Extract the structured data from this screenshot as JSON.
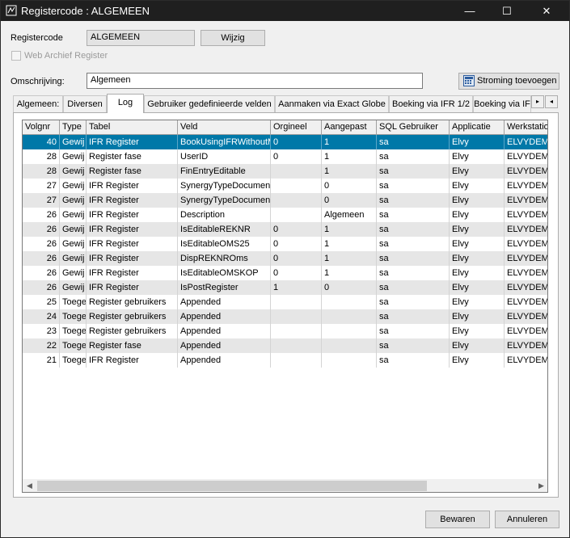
{
  "window": {
    "title": "Registercode : ALGEMEEN",
    "minimize": "—",
    "maximize": "☐",
    "close": "✕"
  },
  "form": {
    "registercode_label": "Registercode",
    "registercode_value": "ALGEMEEN",
    "wijzig_button": "Wijzig",
    "web_archief_label": "Web Archief Register",
    "omschrijving_label": "Omschrijving:",
    "omschrijving_value": "Algemeen",
    "stroming_button": "Stroming toevoegen"
  },
  "tabs": [
    "Algemeen:",
    "Diversen",
    "Log",
    "Gebruiker gedefinieerde velden",
    "Aanmaken via Exact Globe",
    "Boeking via IFR 1/2",
    "Boeking via IF"
  ],
  "tab_scroll": {
    "left": "◂",
    "right": "▸"
  },
  "grid": {
    "columns": [
      "Volgnr",
      "Type",
      "Tabel",
      "Veld",
      "Orgineel",
      "Aangepast",
      "SQL Gebruiker",
      "Applicatie",
      "Werkstatio"
    ],
    "rows": [
      [
        "40",
        "Gewij",
        "IFR Register",
        "BookUsingIFRWithoutM",
        "0",
        "1",
        "sa",
        "Elvy",
        "ELVYDEMO"
      ],
      [
        "28",
        "Gewij",
        "Register fase",
        "UserID",
        "0",
        "1",
        "sa",
        "Elvy",
        "ELVYDEMO"
      ],
      [
        "28",
        "Gewij",
        "Register fase",
        "FinEntryEditable",
        "",
        "1",
        "sa",
        "Elvy",
        "ELVYDEMO"
      ],
      [
        "27",
        "Gewij",
        "IFR Register",
        "SynergyTypeDocumen",
        "",
        "0",
        "sa",
        "Elvy",
        "ELVYDEMO"
      ],
      [
        "27",
        "Gewij",
        "IFR Register",
        "SynergyTypeDocumen",
        "",
        "0",
        "sa",
        "Elvy",
        "ELVYDEMO"
      ],
      [
        "26",
        "Gewij",
        "IFR Register",
        "Description",
        "",
        "Algemeen",
        "sa",
        "Elvy",
        "ELVYDEMO"
      ],
      [
        "26",
        "Gewij",
        "IFR Register",
        "IsEditableREKNR",
        "0",
        "1",
        "sa",
        "Elvy",
        "ELVYDEMO"
      ],
      [
        "26",
        "Gewij",
        "IFR Register",
        "IsEditableOMS25",
        "0",
        "1",
        "sa",
        "Elvy",
        "ELVYDEMO"
      ],
      [
        "26",
        "Gewij",
        "IFR Register",
        "DispREKNROms",
        "0",
        "1",
        "sa",
        "Elvy",
        "ELVYDEMO"
      ],
      [
        "26",
        "Gewij",
        "IFR Register",
        "IsEditableOMSKOP",
        "0",
        "1",
        "sa",
        "Elvy",
        "ELVYDEMO"
      ],
      [
        "26",
        "Gewij",
        "IFR Register",
        "IsPostRegister",
        "1",
        "0",
        "sa",
        "Elvy",
        "ELVYDEMO"
      ],
      [
        "25",
        "Toege",
        "Register gebruikers",
        "Appended",
        "",
        "",
        "sa",
        "Elvy",
        "ELVYDEMO"
      ],
      [
        "24",
        "Toege",
        "Register gebruikers",
        "Appended",
        "",
        "",
        "sa",
        "Elvy",
        "ELVYDEMO"
      ],
      [
        "23",
        "Toege",
        "Register gebruikers",
        "Appended",
        "",
        "",
        "sa",
        "Elvy",
        "ELVYDEMO"
      ],
      [
        "22",
        "Toege",
        "Register fase",
        "Appended",
        "",
        "",
        "sa",
        "Elvy",
        "ELVYDEMO"
      ],
      [
        "21",
        "Toege",
        "IFR Register",
        "Appended",
        "",
        "",
        "sa",
        "Elvy",
        "ELVYDEMO"
      ]
    ]
  },
  "scrollbar": {
    "left": "◀",
    "right": "▶"
  },
  "footer": {
    "save_button": "Bewaren",
    "cancel_button": "Annuleren"
  }
}
